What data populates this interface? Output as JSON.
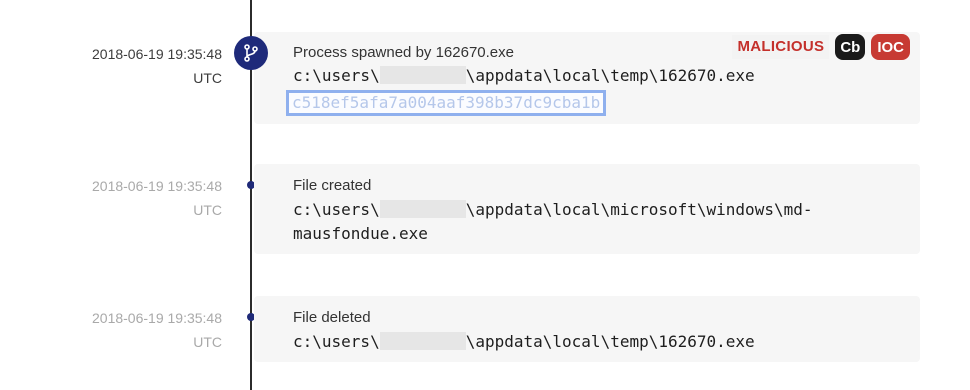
{
  "timeline": {
    "events": [
      {
        "timestamp_date": "2018-06-19 19:35:48",
        "timestamp_tz": "UTC",
        "title": "Process spawned by 162670.exe",
        "path_prefix": "c:\\users\\",
        "path_suffix": "\\appdata\\local\\temp\\162670.exe",
        "hash": "c518ef5afa7a004aaf398b37dc9cba1b",
        "badges": {
          "malicious": "MALICIOUS",
          "cb": "Cb",
          "ioc": "IOC"
        },
        "icon": "process-branch-icon"
      },
      {
        "timestamp_date": "2018-06-19 19:35:48",
        "timestamp_tz": "UTC",
        "title": "File created",
        "path_prefix": "c:\\users\\",
        "path_suffix_line1": "\\appdata\\local\\microsoft\\windows\\md-",
        "path_line2": "mausfondue.exe"
      },
      {
        "timestamp_date": "2018-06-19 19:35:48",
        "timestamp_tz": "UTC",
        "title": "File deleted",
        "path_prefix": "c:\\users\\",
        "path_suffix": "\\appdata\\local\\temp\\162670.exe"
      }
    ]
  },
  "colors": {
    "accent_navy": "#1e2a7a",
    "malicious_red": "#c4302b",
    "ioc_red": "#c73a33",
    "hash_highlight": "#8fb0ee"
  }
}
